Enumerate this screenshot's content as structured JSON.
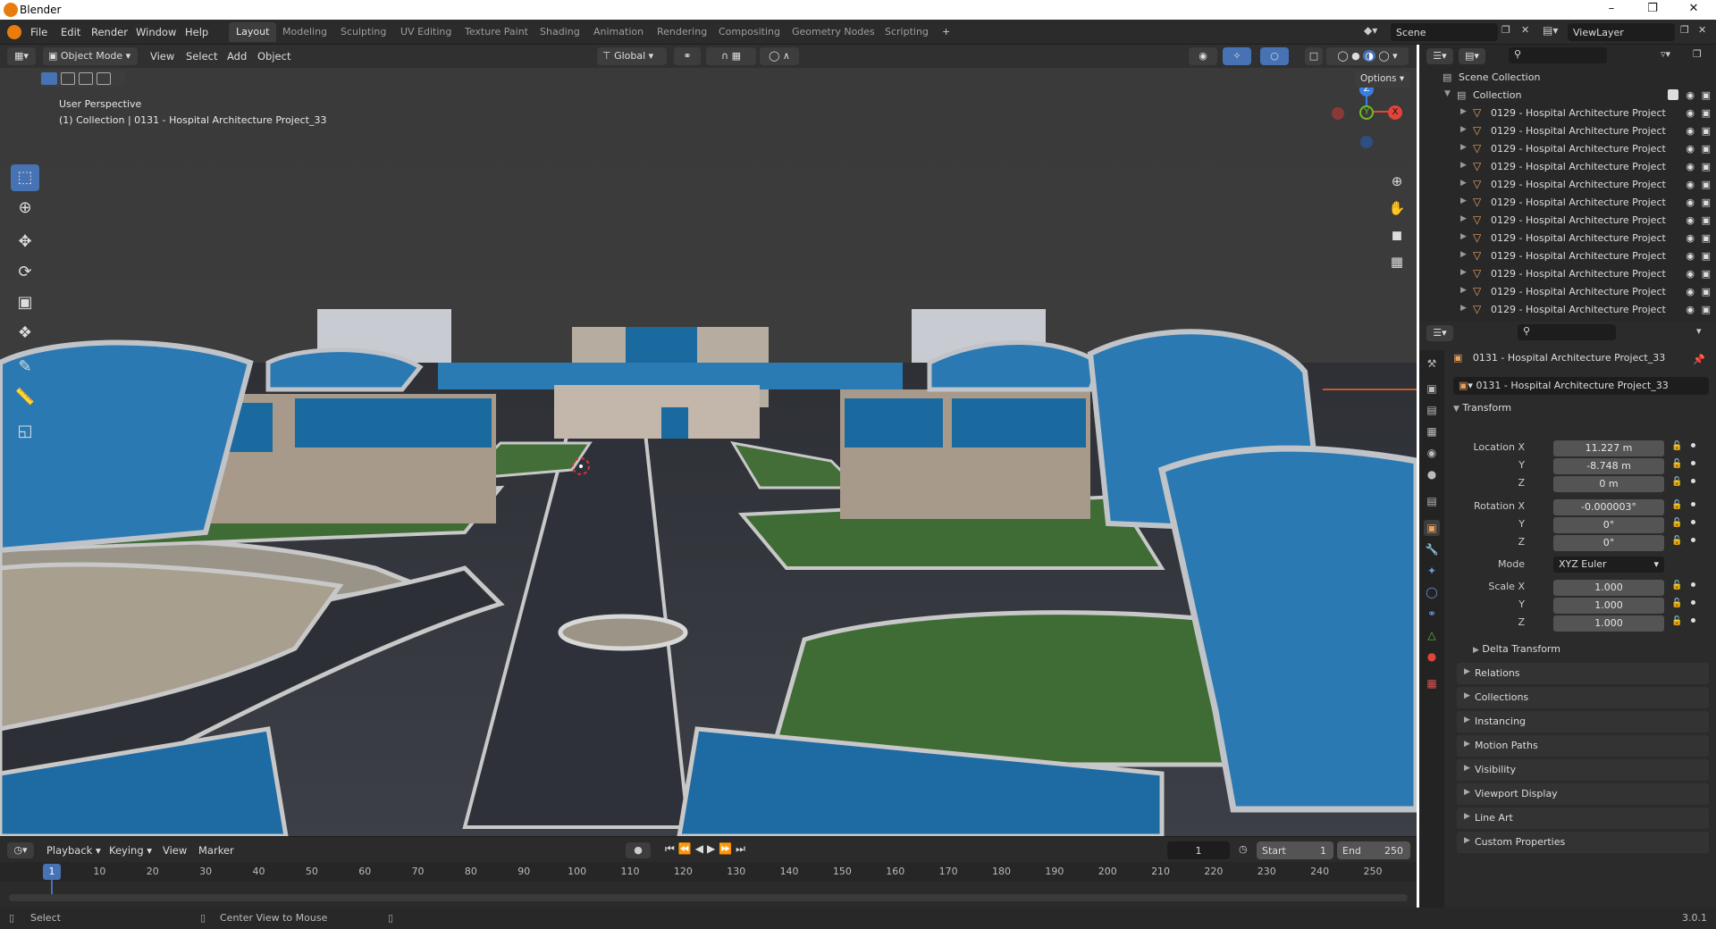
{
  "window": {
    "title": "Blender",
    "controls": [
      "minimize",
      "maximize",
      "close"
    ]
  },
  "menu": [
    "File",
    "Edit",
    "Render",
    "Window",
    "Help"
  ],
  "workspaces": [
    "Layout",
    "Modeling",
    "Sculpting",
    "UV Editing",
    "Texture Paint",
    "Shading",
    "Animation",
    "Rendering",
    "Compositing",
    "Geometry Nodes",
    "Scripting"
  ],
  "active_workspace": "Layout",
  "add_workspace": "+",
  "scene": {
    "name": "Scene",
    "view_layer": "ViewLayer"
  },
  "viewport_header": {
    "mode": "Object Mode",
    "menus": [
      "View",
      "Select",
      "Add",
      "Object"
    ],
    "orientation": "Global",
    "options": "Options"
  },
  "viewport": {
    "perspective": "User Perspective",
    "object_info": "(1) Collection | 0131 - Hospital Architecture Project_33",
    "gizmo_axes": {
      "z": "Z",
      "y": "Y",
      "x": "X"
    }
  },
  "outliner": {
    "root": "Scene Collection",
    "collection": "Collection",
    "items": [
      "0129 - Hospital Architecture Project",
      "0129 - Hospital Architecture Project",
      "0129 - Hospital Architecture Project",
      "0129 - Hospital Architecture Project",
      "0129 - Hospital Architecture Project",
      "0129 - Hospital Architecture Project",
      "0129 - Hospital Architecture Project",
      "0129 - Hospital Architecture Project",
      "0129 - Hospital Architecture Project",
      "0129 - Hospital Architecture Project",
      "0129 - Hospital Architecture Project",
      "0129 - Hospital Architecture Project"
    ]
  },
  "properties": {
    "object_name": "0131 - Hospital Architecture Project_33",
    "object_field": "0131 - Hospital Architecture Project_33",
    "transform": {
      "header": "Transform",
      "location_label": "Location X",
      "location": {
        "x": "11.227 m",
        "y": "-8.748 m",
        "z": "0 m"
      },
      "rotation_label": "Rotation X",
      "rotation": {
        "x": "-0.000003°",
        "y": "0°",
        "z": "0°"
      },
      "mode_label": "Mode",
      "mode": "XYZ Euler",
      "scale_label": "Scale X",
      "scale": {
        "x": "1.000",
        "y": "1.000",
        "z": "1.000"
      },
      "y_label": "Y",
      "z_label": "Z",
      "delta": "Delta Transform"
    },
    "panels": [
      "Relations",
      "Collections",
      "Instancing",
      "Motion Paths",
      "Visibility",
      "Viewport Display",
      "Line Art",
      "Custom Properties"
    ]
  },
  "timeline": {
    "menus": [
      "Playback",
      "Keying",
      "View",
      "Marker"
    ],
    "current_frame": "1",
    "start_label": "Start",
    "start": "1",
    "end_label": "End",
    "end": "250",
    "playhead": "1",
    "ticks": [
      "10",
      "20",
      "30",
      "40",
      "50",
      "60",
      "70",
      "80",
      "90",
      "100",
      "110",
      "120",
      "130",
      "140",
      "150",
      "160",
      "170",
      "180",
      "190",
      "200",
      "210",
      "220",
      "230",
      "240",
      "250"
    ]
  },
  "status": {
    "select": "Select",
    "center": "Center View to Mouse",
    "version": "3.0.1"
  },
  "colors": {
    "accent": "#4772b3",
    "object_orange": "#e8a25f",
    "bg_dark": "#2b2b2b"
  }
}
